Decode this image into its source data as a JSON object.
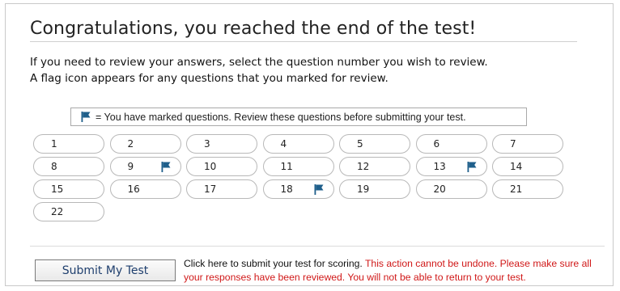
{
  "heading": "Congratulations, you reached the end of the test!",
  "instructions": {
    "line1": "If you need to review your answers, select the question number you wish to review.",
    "line2": "A flag icon appears for any questions that you marked for review."
  },
  "legend": {
    "icon": "flag-icon",
    "text": "= You have marked questions. Review these questions before submitting your test."
  },
  "questions": [
    {
      "number": "1",
      "flagged": false
    },
    {
      "number": "2",
      "flagged": false
    },
    {
      "number": "3",
      "flagged": false
    },
    {
      "number": "4",
      "flagged": false
    },
    {
      "number": "5",
      "flagged": false
    },
    {
      "number": "6",
      "flagged": false
    },
    {
      "number": "7",
      "flagged": false
    },
    {
      "number": "8",
      "flagged": false
    },
    {
      "number": "9",
      "flagged": true
    },
    {
      "number": "10",
      "flagged": false
    },
    {
      "number": "11",
      "flagged": false
    },
    {
      "number": "12",
      "flagged": false
    },
    {
      "number": "13",
      "flagged": true
    },
    {
      "number": "14",
      "flagged": false
    },
    {
      "number": "15",
      "flagged": false
    },
    {
      "number": "16",
      "flagged": false
    },
    {
      "number": "17",
      "flagged": false
    },
    {
      "number": "18",
      "flagged": true
    },
    {
      "number": "19",
      "flagged": false
    },
    {
      "number": "20",
      "flagged": false
    },
    {
      "number": "21",
      "flagged": false
    },
    {
      "number": "22",
      "flagged": false
    }
  ],
  "submit": {
    "button_label": "Submit My Test",
    "note_text": "Click here to submit your test for scoring.",
    "warning_text": "This action cannot be undone. Please make sure all your responses have been reviewed. You will not be able to return to your test."
  },
  "colors": {
    "flag": "#1f5f8b",
    "warning": "#d01818",
    "button_text": "#1f3f6e"
  }
}
